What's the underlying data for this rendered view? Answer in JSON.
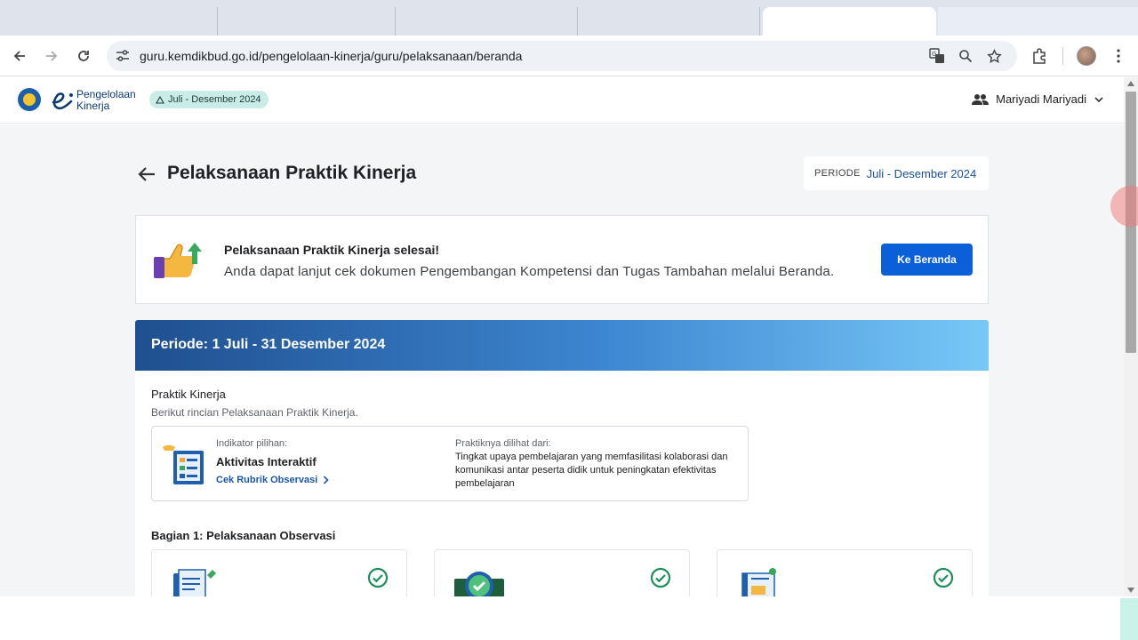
{
  "browser": {
    "url": "guru.kemdikbud.go.id/pengelolaan-kinerja/guru/pelaksanaan/beranda"
  },
  "header": {
    "brand_line1": "Pengelolaan",
    "brand_line2": "Kinerja",
    "period_chip": "Juli - Desember 2024",
    "user_name": "Mariyadi Mariyadi"
  },
  "page": {
    "title": "Pelaksanaan Praktik Kinerja",
    "periode_label": "PERIODE",
    "periode_value": "Juli - Desember 2024"
  },
  "completion": {
    "title": "Pelaksanaan Praktik Kinerja selesai!",
    "message": "Anda dapat lanjut cek dokumen Pengembangan Kompetensi dan Tugas Tambahan melalui Beranda.",
    "button_label": "Ke Beranda"
  },
  "period_banner": "Periode: 1 Juli - 31 Desember 2024",
  "praktik": {
    "title": "Praktik Kinerja",
    "subtitle": "Berikut rincian Pelaksanaan Praktik Kinerja.",
    "indicator_label": "Indikator pilihan:",
    "indicator_name": "Aktivitas Interaktif",
    "rubric_link": "Cek Rubrik Observasi",
    "seen_label": "Praktiknya dilihat dari:",
    "seen_text": "Tingkat upaya pembelajaran yang memfasilitasi kolaborasi dan komunikasi antar peserta didik untuk peningkatan efektivitas pembelajaran"
  },
  "section": {
    "title": "Bagian 1: Pelaksanaan Observasi"
  },
  "colors": {
    "primary_button": "#0b5fd8",
    "banner_start": "#1f4f8f",
    "banner_end": "#78c8f7",
    "check_green": "#1e8e5a",
    "chip_bg": "#c9ece7"
  },
  "icons": [
    "back-icon",
    "forward-icon",
    "reload-icon",
    "site-settings-icon",
    "translate-icon",
    "zoom-icon",
    "bookmark-star-icon",
    "extensions-icon",
    "kebab-menu-icon",
    "people-icon",
    "chevron-down-icon",
    "arrow-left-icon",
    "thumbs-up-icon",
    "chevron-right-icon",
    "check-circle-icon"
  ]
}
